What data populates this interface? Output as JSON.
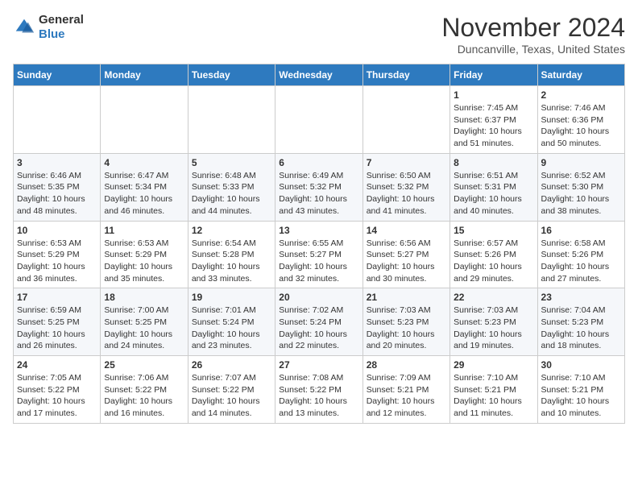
{
  "logo": {
    "general": "General",
    "blue": "Blue"
  },
  "header": {
    "month": "November 2024",
    "location": "Duncanville, Texas, United States"
  },
  "weekdays": [
    "Sunday",
    "Monday",
    "Tuesday",
    "Wednesday",
    "Thursday",
    "Friday",
    "Saturday"
  ],
  "weeks": [
    [
      {
        "day": "",
        "info": ""
      },
      {
        "day": "",
        "info": ""
      },
      {
        "day": "",
        "info": ""
      },
      {
        "day": "",
        "info": ""
      },
      {
        "day": "",
        "info": ""
      },
      {
        "day": "1",
        "info": "Sunrise: 7:45 AM\nSunset: 6:37 PM\nDaylight: 10 hours and 51 minutes."
      },
      {
        "day": "2",
        "info": "Sunrise: 7:46 AM\nSunset: 6:36 PM\nDaylight: 10 hours and 50 minutes."
      }
    ],
    [
      {
        "day": "3",
        "info": "Sunrise: 6:46 AM\nSunset: 5:35 PM\nDaylight: 10 hours and 48 minutes."
      },
      {
        "day": "4",
        "info": "Sunrise: 6:47 AM\nSunset: 5:34 PM\nDaylight: 10 hours and 46 minutes."
      },
      {
        "day": "5",
        "info": "Sunrise: 6:48 AM\nSunset: 5:33 PM\nDaylight: 10 hours and 44 minutes."
      },
      {
        "day": "6",
        "info": "Sunrise: 6:49 AM\nSunset: 5:32 PM\nDaylight: 10 hours and 43 minutes."
      },
      {
        "day": "7",
        "info": "Sunrise: 6:50 AM\nSunset: 5:32 PM\nDaylight: 10 hours and 41 minutes."
      },
      {
        "day": "8",
        "info": "Sunrise: 6:51 AM\nSunset: 5:31 PM\nDaylight: 10 hours and 40 minutes."
      },
      {
        "day": "9",
        "info": "Sunrise: 6:52 AM\nSunset: 5:30 PM\nDaylight: 10 hours and 38 minutes."
      }
    ],
    [
      {
        "day": "10",
        "info": "Sunrise: 6:53 AM\nSunset: 5:29 PM\nDaylight: 10 hours and 36 minutes."
      },
      {
        "day": "11",
        "info": "Sunrise: 6:53 AM\nSunset: 5:29 PM\nDaylight: 10 hours and 35 minutes."
      },
      {
        "day": "12",
        "info": "Sunrise: 6:54 AM\nSunset: 5:28 PM\nDaylight: 10 hours and 33 minutes."
      },
      {
        "day": "13",
        "info": "Sunrise: 6:55 AM\nSunset: 5:27 PM\nDaylight: 10 hours and 32 minutes."
      },
      {
        "day": "14",
        "info": "Sunrise: 6:56 AM\nSunset: 5:27 PM\nDaylight: 10 hours and 30 minutes."
      },
      {
        "day": "15",
        "info": "Sunrise: 6:57 AM\nSunset: 5:26 PM\nDaylight: 10 hours and 29 minutes."
      },
      {
        "day": "16",
        "info": "Sunrise: 6:58 AM\nSunset: 5:26 PM\nDaylight: 10 hours and 27 minutes."
      }
    ],
    [
      {
        "day": "17",
        "info": "Sunrise: 6:59 AM\nSunset: 5:25 PM\nDaylight: 10 hours and 26 minutes."
      },
      {
        "day": "18",
        "info": "Sunrise: 7:00 AM\nSunset: 5:25 PM\nDaylight: 10 hours and 24 minutes."
      },
      {
        "day": "19",
        "info": "Sunrise: 7:01 AM\nSunset: 5:24 PM\nDaylight: 10 hours and 23 minutes."
      },
      {
        "day": "20",
        "info": "Sunrise: 7:02 AM\nSunset: 5:24 PM\nDaylight: 10 hours and 22 minutes."
      },
      {
        "day": "21",
        "info": "Sunrise: 7:03 AM\nSunset: 5:23 PM\nDaylight: 10 hours and 20 minutes."
      },
      {
        "day": "22",
        "info": "Sunrise: 7:03 AM\nSunset: 5:23 PM\nDaylight: 10 hours and 19 minutes."
      },
      {
        "day": "23",
        "info": "Sunrise: 7:04 AM\nSunset: 5:23 PM\nDaylight: 10 hours and 18 minutes."
      }
    ],
    [
      {
        "day": "24",
        "info": "Sunrise: 7:05 AM\nSunset: 5:22 PM\nDaylight: 10 hours and 17 minutes."
      },
      {
        "day": "25",
        "info": "Sunrise: 7:06 AM\nSunset: 5:22 PM\nDaylight: 10 hours and 16 minutes."
      },
      {
        "day": "26",
        "info": "Sunrise: 7:07 AM\nSunset: 5:22 PM\nDaylight: 10 hours and 14 minutes."
      },
      {
        "day": "27",
        "info": "Sunrise: 7:08 AM\nSunset: 5:22 PM\nDaylight: 10 hours and 13 minutes."
      },
      {
        "day": "28",
        "info": "Sunrise: 7:09 AM\nSunset: 5:21 PM\nDaylight: 10 hours and 12 minutes."
      },
      {
        "day": "29",
        "info": "Sunrise: 7:10 AM\nSunset: 5:21 PM\nDaylight: 10 hours and 11 minutes."
      },
      {
        "day": "30",
        "info": "Sunrise: 7:10 AM\nSunset: 5:21 PM\nDaylight: 10 hours and 10 minutes."
      }
    ]
  ]
}
